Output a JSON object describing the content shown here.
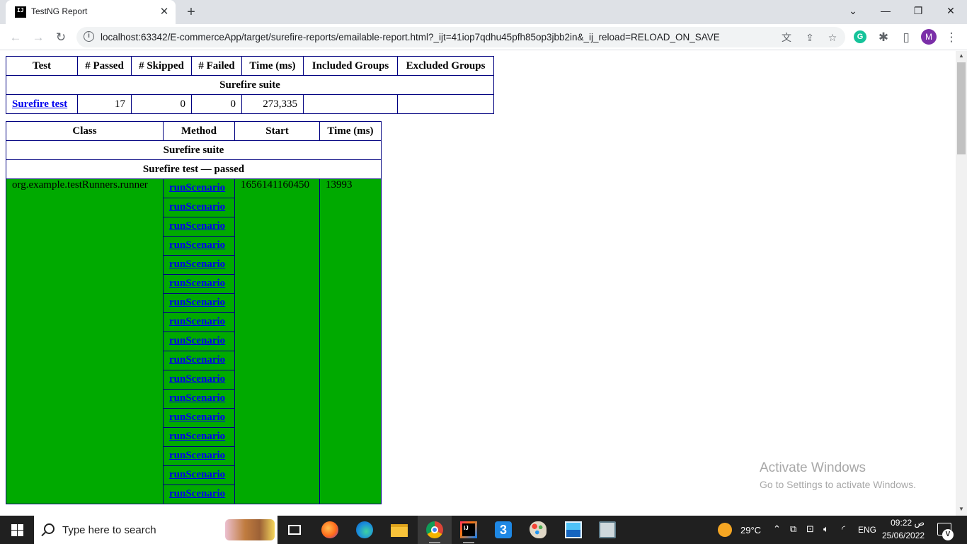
{
  "browser": {
    "tab_title": "TestNG Report",
    "favicon_text": "IJ",
    "close_glyph": "✕",
    "new_tab_glyph": "+",
    "url": "localhost:63342/E-commerceApp/target/surefire-reports/emailable-report.html?_ijt=41iop7qdhu45pfh85op3jbb2in&_ij_reload=RELOAD_ON_SAVE",
    "profile_initial": "M",
    "grammarly_initial": "G"
  },
  "summary": {
    "headers": [
      "Test",
      "# Passed",
      "# Skipped",
      "# Failed",
      "Time (ms)",
      "Included Groups",
      "Excluded Groups"
    ],
    "suite_name": "Surefire suite",
    "row": {
      "test": "Surefire test",
      "passed": "17",
      "skipped": "0",
      "failed": "0",
      "time": "273,335",
      "included": "",
      "excluded": ""
    }
  },
  "details": {
    "headers": [
      "Class",
      "Method",
      "Start",
      "Time (ms)"
    ],
    "suite_name": "Surefire suite",
    "test_title": "Surefire test — passed",
    "class_name": "org.example.testRunners.runner",
    "start": "1656141160450",
    "time": "13993",
    "methods": [
      "runScenario",
      "runScenario",
      "runScenario",
      "runScenario",
      "runScenario",
      "runScenario",
      "runScenario",
      "runScenario",
      "runScenario",
      "runScenario",
      "runScenario",
      "runScenario",
      "runScenario",
      "runScenario",
      "runScenario",
      "runScenario",
      "runScenario"
    ],
    "pass_color": "#00aa00"
  },
  "watermark": {
    "line1": "Activate Windows",
    "line2": "Go to Settings to activate Windows."
  },
  "taskbar": {
    "search_placeholder": "Type here to search",
    "temperature": "29°C",
    "language": "ENG",
    "time": "09:22 ص",
    "date": "25/06/2022",
    "notification_count": "V"
  }
}
